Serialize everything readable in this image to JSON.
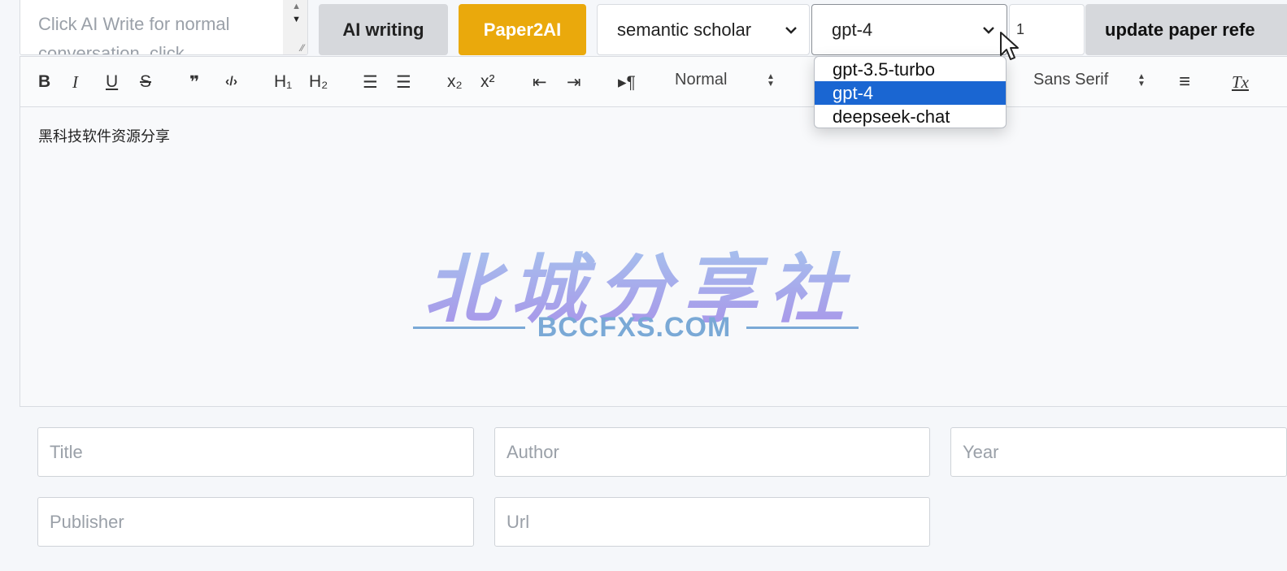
{
  "prompt": {
    "placeholder_line1": "Click AI Write for normal",
    "placeholder_line2": "conversation, click"
  },
  "buttons": {
    "ai_writing": "AI writing",
    "paper2ai": "Paper2AI",
    "update_paper": "update paper refe"
  },
  "source_select": {
    "value": "semantic scholar"
  },
  "model_select": {
    "value": "gpt-4",
    "options": [
      "gpt-3.5-turbo",
      "gpt-4",
      "deepseek-chat"
    ],
    "selected_index": 1
  },
  "count_input": {
    "value": "1"
  },
  "toolbar": {
    "bold": "B",
    "italic": "I",
    "underline": "U",
    "strike": "S",
    "quote": "❞",
    "code": "‹/›",
    "h1": "H₁",
    "h2": "H₂",
    "ordered_list": "☰",
    "bullet_list": "☰",
    "subscript": "x₂",
    "superscript": "x²",
    "outdent": "⇤",
    "indent": "⇥",
    "direction": "▸¶",
    "header_select": "Normal",
    "font_select": "Sans Serif",
    "align": "≡",
    "clear_format": "Tx"
  },
  "editor": {
    "content": "黑科技软件资源分享"
  },
  "watermark": {
    "title": "北城分享社",
    "subtitle": "BCCFXS.COM"
  },
  "form": {
    "title_placeholder": "Title",
    "author_placeholder": "Author",
    "year_placeholder": "Year",
    "publisher_placeholder": "Publisher",
    "url_placeholder": "Url"
  },
  "colors": {
    "accent_orange": "#eaa90c",
    "selected_blue": "#1a66d2",
    "button_gray": "#d6d8dc"
  }
}
